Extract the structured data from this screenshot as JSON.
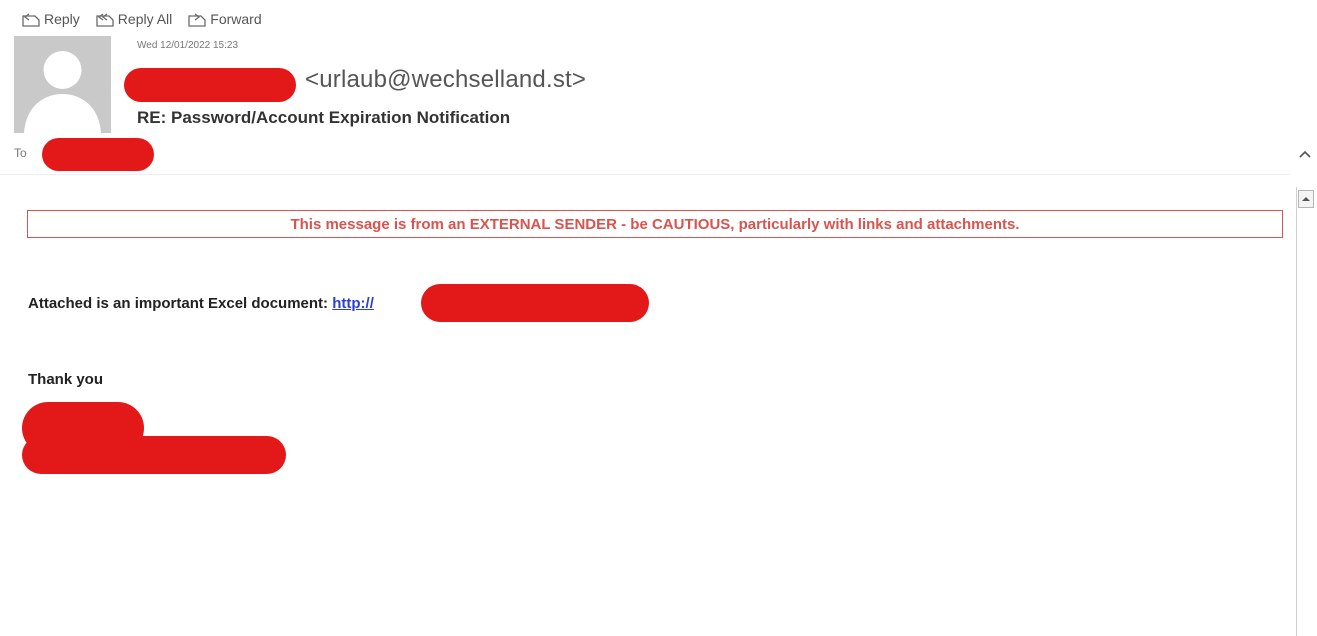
{
  "toolbar": {
    "reply_label": "Reply",
    "reply_all_label": "Reply All",
    "forward_label": "Forward"
  },
  "header": {
    "timestamp": "Wed 12/01/2022 15:23",
    "sender_email": "<urlaub@wechselland.st>",
    "subject": "RE: Password/Account Expiration Notification",
    "to_label": "To"
  },
  "message": {
    "warning_banner": "This message is from an EXTERNAL SENDER - be CAUTIOUS, particularly with links and attachments.",
    "body_text": "Attached is an important Excel document: ",
    "link_text": "http://",
    "closing": "Thank you"
  },
  "colors": {
    "redaction": "#e31818",
    "warning": "#d9534f",
    "link": "#2b3fd1"
  },
  "icons": {
    "reply": "reply-icon",
    "reply_all": "reply-all-icon",
    "forward": "forward-icon",
    "collapse": "chevron-up-icon",
    "scroll_up": "scroll-up-arrow-icon"
  }
}
